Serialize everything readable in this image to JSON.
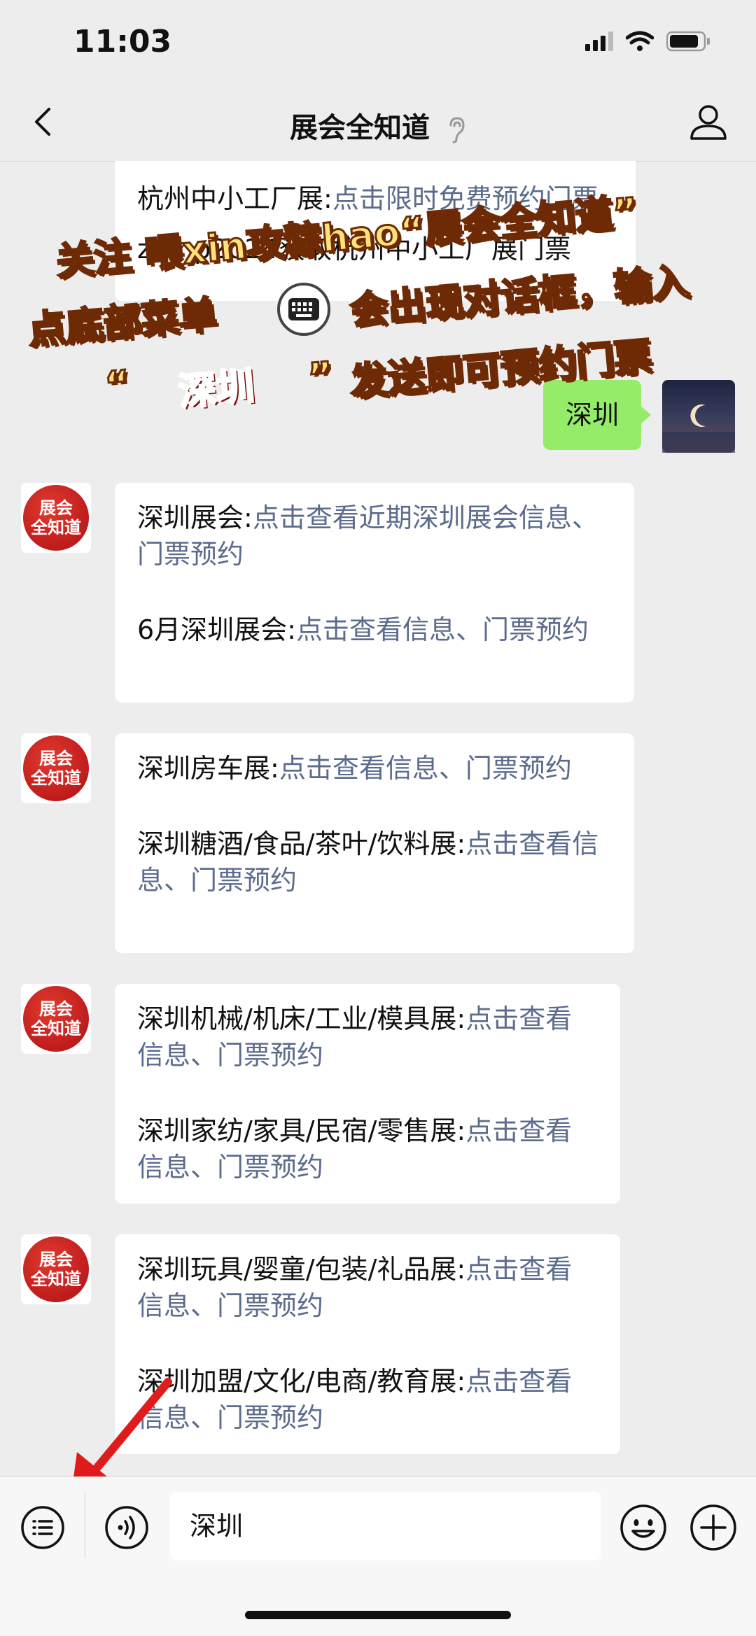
{
  "status": {
    "time": "11:03"
  },
  "nav": {
    "title": "展会全知道"
  },
  "brand": {
    "avatar_line1": "展会",
    "avatar_line2": "全知道"
  },
  "messages": [
    {
      "first_label": "杭州中小工厂展:",
      "first_link": "点击限时免费预约门票",
      "first_tail_visible": "zhmp2024获取杭州中小工厂展门票"
    },
    {
      "items": [
        {
          "label": "深圳展会:",
          "link": "点击查看近期深圳展会信息、门票预约"
        },
        {
          "label": "6月深圳展会:",
          "link": "点击查看信息、门票预约"
        }
      ]
    },
    {
      "items": [
        {
          "label": "深圳房车展:",
          "link": "点击查看信息、门票预约"
        },
        {
          "label": "深圳糖酒/食品/茶叶/饮料展:",
          "link": "点击查看信息、门票预约"
        }
      ]
    },
    {
      "items": [
        {
          "label": "深圳机械/机床/工业/模具展:",
          "link": "点击查看信息、门票预约"
        },
        {
          "label": "深圳家纺/家具/民宿/零售展:",
          "link": "点击查看信息、门票预约"
        }
      ]
    },
    {
      "items": [
        {
          "label": "深圳玩具/婴童/包装/礼品展:",
          "link": "点击查看信息、门票预约"
        },
        {
          "label": "深圳加盟/文化/电商/教育展:",
          "link": "点击查看信息、门票预约"
        }
      ]
    }
  ],
  "user_message": "深圳",
  "overlay": {
    "line1": "关注 喂xin攻粽hao“展会全知道”",
    "line2a": "点底部菜单",
    "line2b": "会出现对话框，输入",
    "line3_open": "“",
    "line3_keyword": "深圳",
    "line3_close": "”",
    "line3_tail": "发送即可预约门票"
  },
  "input": {
    "value": "深圳"
  },
  "colors": {
    "link": "#5b6b8c",
    "user_bubble": "#95ec69",
    "overlay_text": "#ffe27a",
    "keyword": "#e31d1d"
  }
}
